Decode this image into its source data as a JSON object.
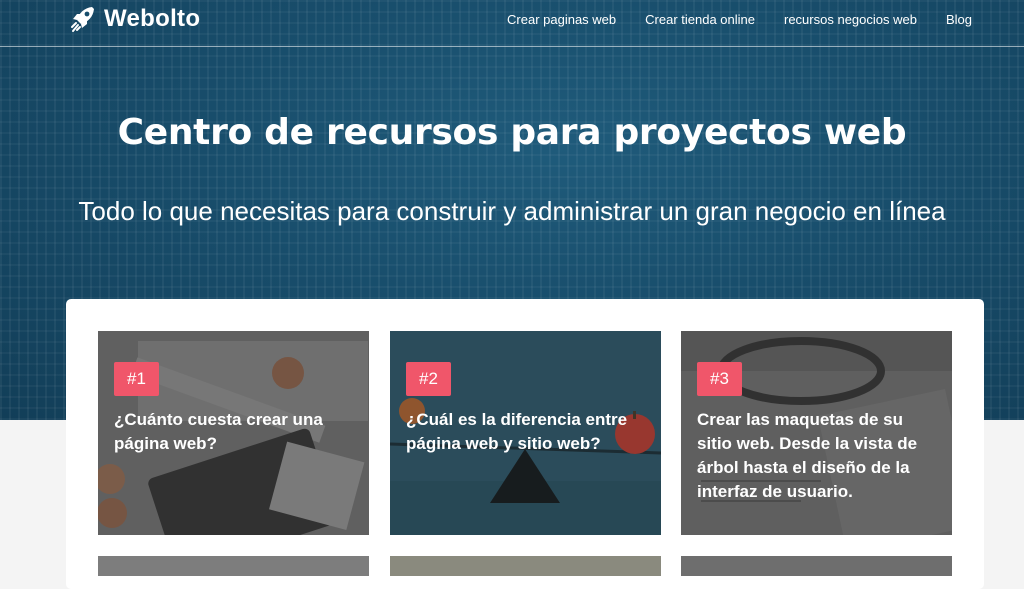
{
  "brand": {
    "name": "Webolto",
    "icon": "rocket-icon"
  },
  "nav": {
    "links": [
      "Crear paginas web",
      "Crear tienda online",
      "recursos negocios web",
      "Blog"
    ]
  },
  "hero": {
    "title": "Centro de recursos para proyectos web",
    "subtitle": "Todo lo que necesitas para construir y administrar un gran negocio en línea"
  },
  "cards": [
    {
      "badge": "#1",
      "title": "¿Cuánto cuesta crear una página web?"
    },
    {
      "badge": "#2",
      "title": "¿Cuál es la diferencia entre página web y sitio web?"
    },
    {
      "badge": "#3",
      "title": "Crear las maquetas de su sitio web. Desde la vista de árbol hasta el diseño de la interfaz de usuario."
    }
  ],
  "colors": {
    "hero_bg": "#184d6b",
    "badge": "#f0566a",
    "panel": "#ffffff"
  }
}
